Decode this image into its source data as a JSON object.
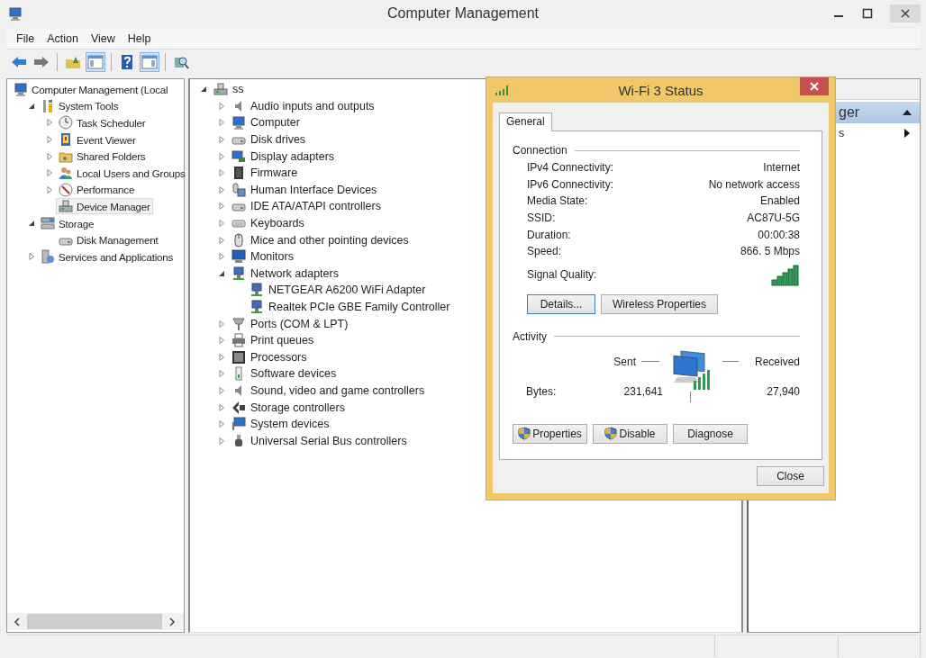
{
  "window": {
    "title": "Computer Management"
  },
  "menu": [
    "File",
    "Action",
    "View",
    "Help"
  ],
  "toolbar": [
    {
      "on": false
    },
    {
      "on": false
    },
    {
      "on": false
    },
    {
      "on": true
    },
    {
      "on": false
    },
    {
      "on": true
    },
    {
      "on": false
    }
  ],
  "nav_tree": [
    {
      "label": "Computer Management (Local",
      "selected": false,
      "children": [
        {
          "label": "System Tools",
          "expanded": true,
          "selected": false,
          "children": [
            {
              "label": "Task Scheduler",
              "expanded": false,
              "selected": false
            },
            {
              "label": "Event Viewer",
              "expanded": false,
              "selected": false
            },
            {
              "label": "Shared Folders",
              "expanded": false,
              "selected": false
            },
            {
              "label": "Local Users and Groups",
              "expanded": false,
              "selected": false
            },
            {
              "label": "Performance",
              "expanded": false,
              "selected": false
            },
            {
              "label": "Device Manager",
              "selected": true
            }
          ]
        },
        {
          "label": "Storage",
          "expanded": true,
          "selected": false,
          "children": [
            {
              "label": "Disk Management",
              "selected": false
            }
          ]
        },
        {
          "label": "Services and Applications",
          "expanded": false,
          "selected": false
        }
      ]
    }
  ],
  "device_tree": [
    {
      "label": "ss",
      "expanded": true,
      "children": [
        {
          "label": "Audio inputs and outputs",
          "expanded": false
        },
        {
          "label": "Computer",
          "expanded": false
        },
        {
          "label": "Disk drives",
          "expanded": false
        },
        {
          "label": "Display adapters",
          "expanded": false
        },
        {
          "label": "Firmware",
          "expanded": false
        },
        {
          "label": "Human Interface Devices",
          "expanded": false
        },
        {
          "label": "IDE ATA/ATAPI controllers",
          "expanded": false
        },
        {
          "label": "Keyboards",
          "expanded": false
        },
        {
          "label": "Mice and other pointing devices",
          "expanded": false
        },
        {
          "label": "Monitors",
          "expanded": false
        },
        {
          "label": "Network adapters",
          "expanded": true,
          "children": [
            {
              "label": "NETGEAR A6200 WiFi Adapter"
            },
            {
              "label": "Realtek PCIe GBE Family Controller"
            }
          ]
        },
        {
          "label": "Ports (COM & LPT)",
          "expanded": false
        },
        {
          "label": "Print queues",
          "expanded": false
        },
        {
          "label": "Processors",
          "expanded": false
        },
        {
          "label": "Software devices",
          "expanded": false
        },
        {
          "label": "Sound, video and game controllers",
          "expanded": false
        },
        {
          "label": "Storage controllers",
          "expanded": false
        },
        {
          "label": "System devices",
          "expanded": false
        },
        {
          "label": "Universal Serial Bus controllers",
          "expanded": false
        }
      ]
    }
  ],
  "actions_pane": {
    "header": "ger",
    "items": [
      "s"
    ]
  },
  "dialog": {
    "title": "Wi-Fi 3 Status",
    "tabs": [
      {
        "label": "General",
        "selected": true
      }
    ],
    "connection": {
      "heading": "Connection",
      "fields": [
        {
          "kind": "text",
          "label": "IPv4 Connectivity:",
          "value": "Internet"
        },
        {
          "kind": "text",
          "label": "IPv6 Connectivity:",
          "value": "No network access"
        },
        {
          "kind": "text",
          "label": "Media State:",
          "value": "Enabled"
        },
        {
          "kind": "text",
          "label": "SSID:",
          "value": "AC87U-5G"
        },
        {
          "kind": "text",
          "label": "Duration:",
          "value": "00:00:38"
        },
        {
          "kind": "text",
          "label": "Speed:",
          "value": "866. 5 Mbps"
        },
        {
          "kind": "signal",
          "label": "Signal Quality:"
        }
      ],
      "buttons": [
        {
          "label": "Details...",
          "focused": true
        },
        {
          "label": "Wireless Properties",
          "focused": false
        }
      ]
    },
    "activity": {
      "heading": "Activity",
      "sent_label": "Sent",
      "received_label": "Received",
      "bytes_label": "Bytes:",
      "sent": "231,641",
      "received": "27,940",
      "buttons": [
        {
          "label": "Properties",
          "shield": true
        },
        {
          "label": "Disable",
          "shield": true
        },
        {
          "label": "Diagnose",
          "shield": false
        }
      ]
    },
    "close_button": "Close"
  }
}
